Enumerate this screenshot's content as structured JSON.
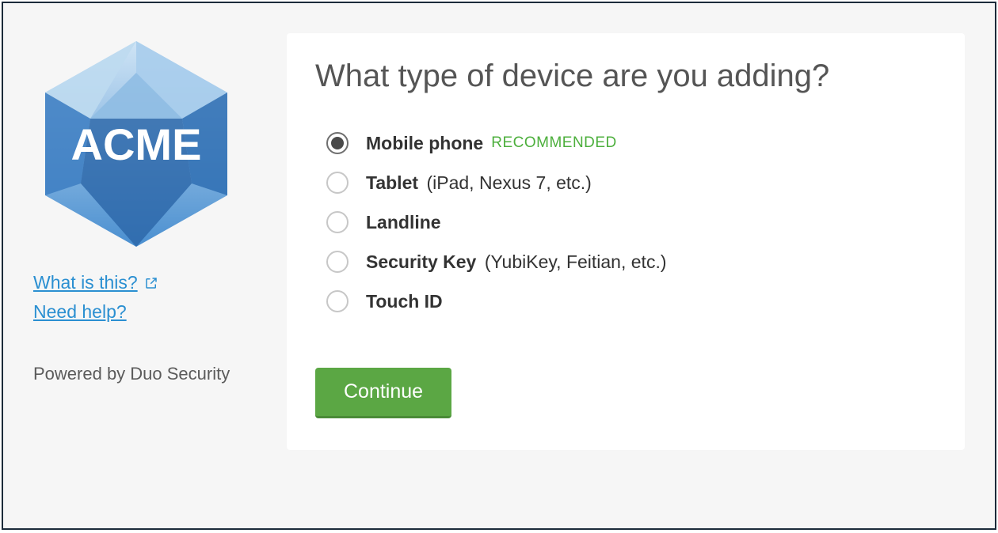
{
  "sidebar": {
    "logo_text": "ACME",
    "links": {
      "what_is_this": "What is this?",
      "need_help": "Need help?"
    },
    "powered": "Powered by Duo Security"
  },
  "main": {
    "heading": "What type of device are you adding?",
    "options": [
      {
        "label": "Mobile phone",
        "hint": "",
        "badge": "RECOMMENDED",
        "selected": true
      },
      {
        "label": "Tablet",
        "hint": "(iPad, Nexus 7, etc.)",
        "badge": "",
        "selected": false
      },
      {
        "label": "Landline",
        "hint": "",
        "badge": "",
        "selected": false
      },
      {
        "label": "Security Key",
        "hint": "(YubiKey, Feitian, etc.)",
        "badge": "",
        "selected": false
      },
      {
        "label": "Touch ID",
        "hint": "",
        "badge": "",
        "selected": false
      }
    ],
    "continue_label": "Continue"
  }
}
